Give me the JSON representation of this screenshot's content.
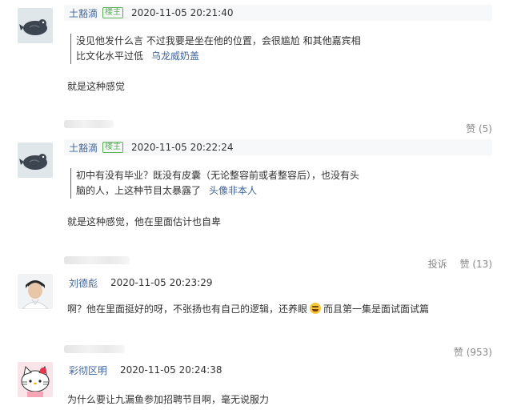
{
  "comments": [
    {
      "user": "土豁滴",
      "tag": "楼主",
      "time": "2020-11-05 20:21:40",
      "quote_line1": "没见他发什么言 不过我要是坐在他的位置，会很尴尬 和其他嘉宾相",
      "quote_line2": "比文化水平过低",
      "quote_author": "乌龙威奶盖",
      "text": "就是这种感觉",
      "like_label": "赞 (5)",
      "avatar": "bird-avatar"
    },
    {
      "user": "土豁滴",
      "tag": "楼主",
      "time": "2020-11-05 20:22:24",
      "quote_line1": "初中有没有毕业？既没有皮囊（无论整容前或者整容后），也没有头",
      "quote_line2": "脑的人，上这种节目太暴露了",
      "quote_author": "头像非本人",
      "text": "就是这种感觉，他在里面估计也自卑",
      "report_label": "投诉",
      "like_label": "赞 (13)",
      "avatar": "bird-avatar"
    },
    {
      "user": "刘德彪",
      "time": "2020-11-05 20:23:29",
      "text_before": "啊？他在里面挺好的呀，不张扬也有自己的逻辑，还养眼",
      "text_after": "而且第一集是面试面试篇",
      "emoji": "grin-emoji",
      "like_label": "赞 (953)",
      "avatar": "man-avatar"
    },
    {
      "user": "彩彻区明",
      "time": "2020-11-05 20:24:38",
      "text": "为什么要让九漏鱼参加招聘节目啊，毫无说服力",
      "avatar": "hello-kitty-avatar"
    }
  ]
}
